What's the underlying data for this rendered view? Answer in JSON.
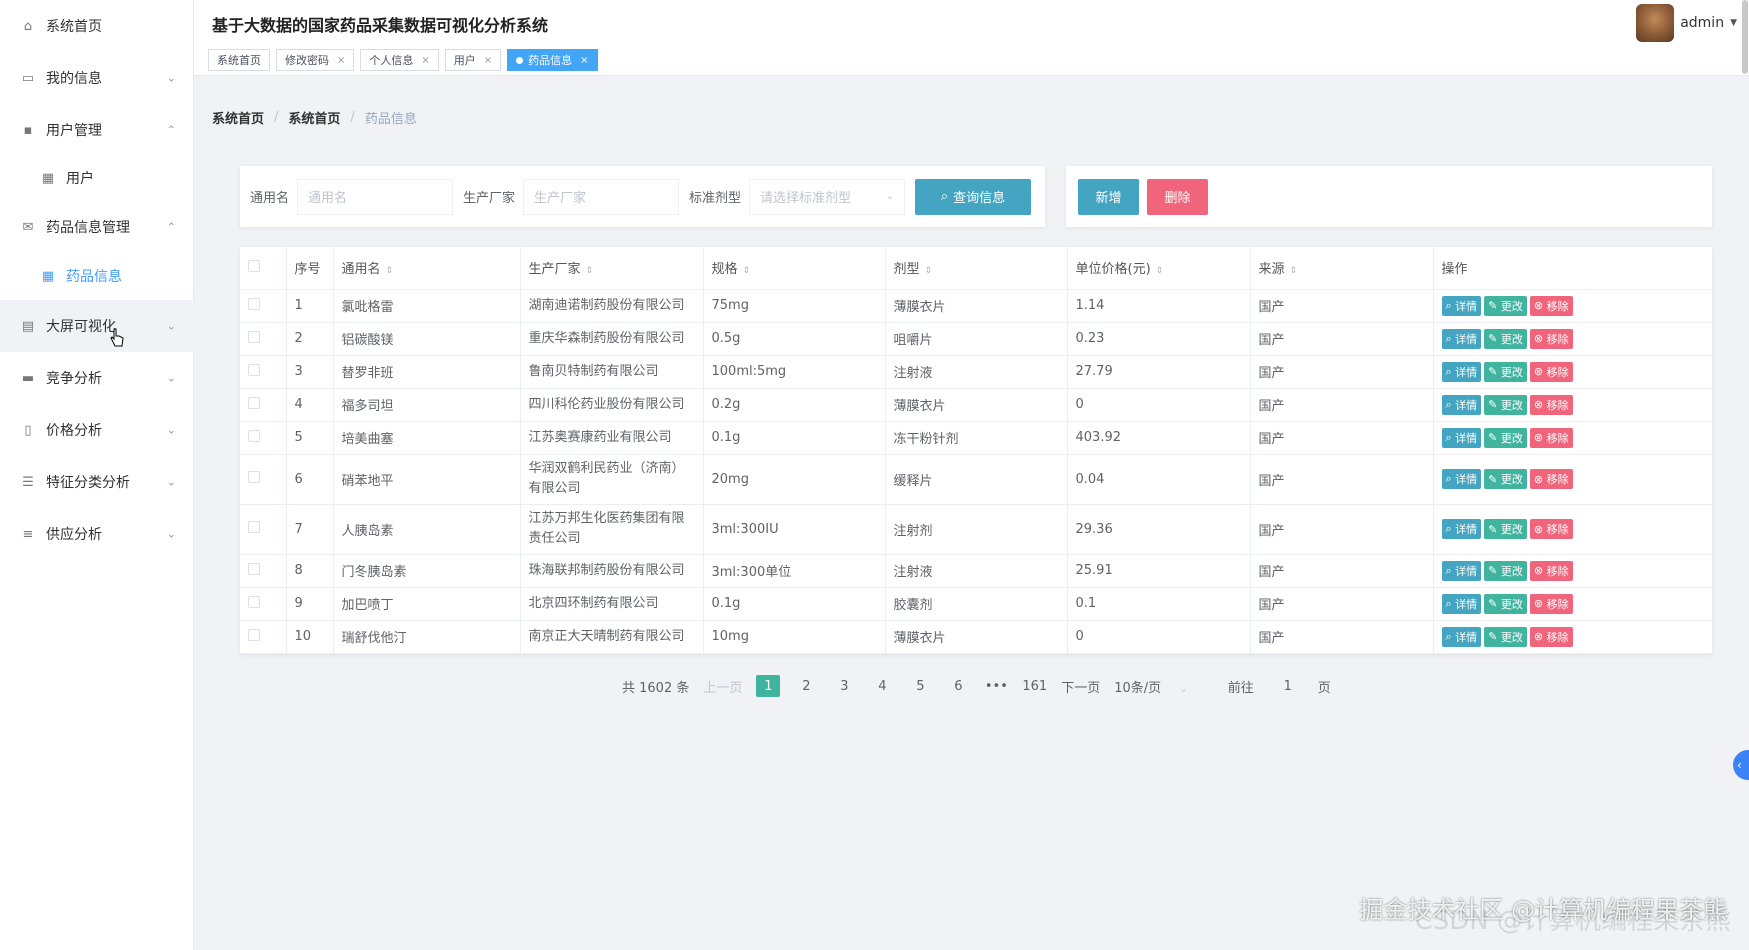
{
  "app": {
    "title": "基于大数据的国家药品采集数据可视化分析系统"
  },
  "user": {
    "name": "admin"
  },
  "sidebar": {
    "items": [
      {
        "label": "系统首页",
        "icon": "home-icon"
      },
      {
        "label": "我的信息",
        "icon": "profile-icon"
      },
      {
        "label": "用户管理",
        "icon": "chat-icon"
      },
      {
        "label": "用户",
        "icon": "grid-icon"
      },
      {
        "label": "药品信息管理",
        "icon": "mail-icon"
      },
      {
        "label": "药品信息",
        "icon": "grid-icon"
      },
      {
        "label": "大屏可视化",
        "icon": "clipboard-icon"
      },
      {
        "label": "竞争分析",
        "icon": "monitor-icon"
      },
      {
        "label": "价格分析",
        "icon": "phone-icon"
      },
      {
        "label": "特征分类分析",
        "icon": "sliders-icon"
      },
      {
        "label": "供应分析",
        "icon": "list-icon"
      }
    ]
  },
  "tabs": [
    {
      "label": "系统首页"
    },
    {
      "label": "修改密码"
    },
    {
      "label": "个人信息"
    },
    {
      "label": "用户"
    },
    {
      "label": "药品信息"
    }
  ],
  "breadcrumb": [
    "系统首页",
    "系统首页",
    "药品信息"
  ],
  "search": {
    "name_label": "通用名",
    "name_placeholder": "通用名",
    "maker_label": "生产厂家",
    "maker_placeholder": "生产厂家",
    "form_label": "标准剂型",
    "form_placeholder": "请选择标准剂型",
    "query_button": "查询信息"
  },
  "actions": {
    "add": "新增",
    "delete": "删除"
  },
  "table": {
    "headers": [
      "序号",
      "通用名",
      "生产厂家",
      "规格",
      "剂型",
      "单位价格(元)",
      "来源",
      "操作"
    ],
    "op_labels": {
      "detail": "详情",
      "edit": "更改",
      "remove": "移除"
    },
    "rows": [
      {
        "no": "1",
        "name": "氯吡格雷",
        "maker": "湖南迪诺制药股份有限公司",
        "spec": "75mg",
        "form": "薄膜衣片",
        "price": "1.14",
        "source": "国产"
      },
      {
        "no": "2",
        "name": "铝碳酸镁",
        "maker": "重庆华森制药股份有限公司",
        "spec": "0.5g",
        "form": "咀嚼片",
        "price": "0.23",
        "source": "国产"
      },
      {
        "no": "3",
        "name": "替罗非班",
        "maker": "鲁南贝特制药有限公司",
        "spec": "100ml:5mg",
        "form": "注射液",
        "price": "27.79",
        "source": "国产"
      },
      {
        "no": "4",
        "name": "福多司坦",
        "maker": "四川科伦药业股份有限公司",
        "spec": "0.2g",
        "form": "薄膜衣片",
        "price": "0",
        "source": "国产"
      },
      {
        "no": "5",
        "name": "培美曲塞",
        "maker": "江苏奥赛康药业有限公司",
        "spec": "0.1g",
        "form": "冻干粉针剂",
        "price": "403.92",
        "source": "国产"
      },
      {
        "no": "6",
        "name": "硝苯地平",
        "maker": "华润双鹤利民药业（济南）有限公司",
        "spec": "20mg",
        "form": "缓释片",
        "price": "0.04",
        "source": "国产"
      },
      {
        "no": "7",
        "name": "人胰岛素",
        "maker": "江苏万邦生化医药集团有限责任公司",
        "spec": "3ml:300IU",
        "form": "注射剂",
        "price": "29.36",
        "source": "国产"
      },
      {
        "no": "8",
        "name": "门冬胰岛素",
        "maker": "珠海联邦制药股份有限公司",
        "spec": "3ml:300单位",
        "form": "注射液",
        "price": "25.91",
        "source": "国产"
      },
      {
        "no": "9",
        "name": "加巴喷丁",
        "maker": "北京四环制药有限公司",
        "spec": "0.1g",
        "form": "胶囊剂",
        "price": "0.1",
        "source": "国产"
      },
      {
        "no": "10",
        "name": "瑞舒伐他汀",
        "maker": "南京正大天晴制药有限公司",
        "spec": "10mg",
        "form": "薄膜衣片",
        "price": "0",
        "source": "国产"
      }
    ]
  },
  "pagination": {
    "total": "共 1602 条",
    "prev": "上一页",
    "pages": [
      "1",
      "2",
      "3",
      "4",
      "5",
      "6"
    ],
    "ellipsis": "•••",
    "last": "161",
    "next": "下一页",
    "page_size": "10条/页",
    "goto_label": "前往",
    "goto_value": "1",
    "goto_unit": "页"
  },
  "watermark": {
    "text": "掘金技术社区 @计算机编程果茶熊",
    "sub": "CSDN @计算机编程果茶熊"
  },
  "colors": {
    "accent": "#409eff",
    "teal": "#43a5c2",
    "green": "#41b4a0",
    "pink": "#f0657b"
  }
}
